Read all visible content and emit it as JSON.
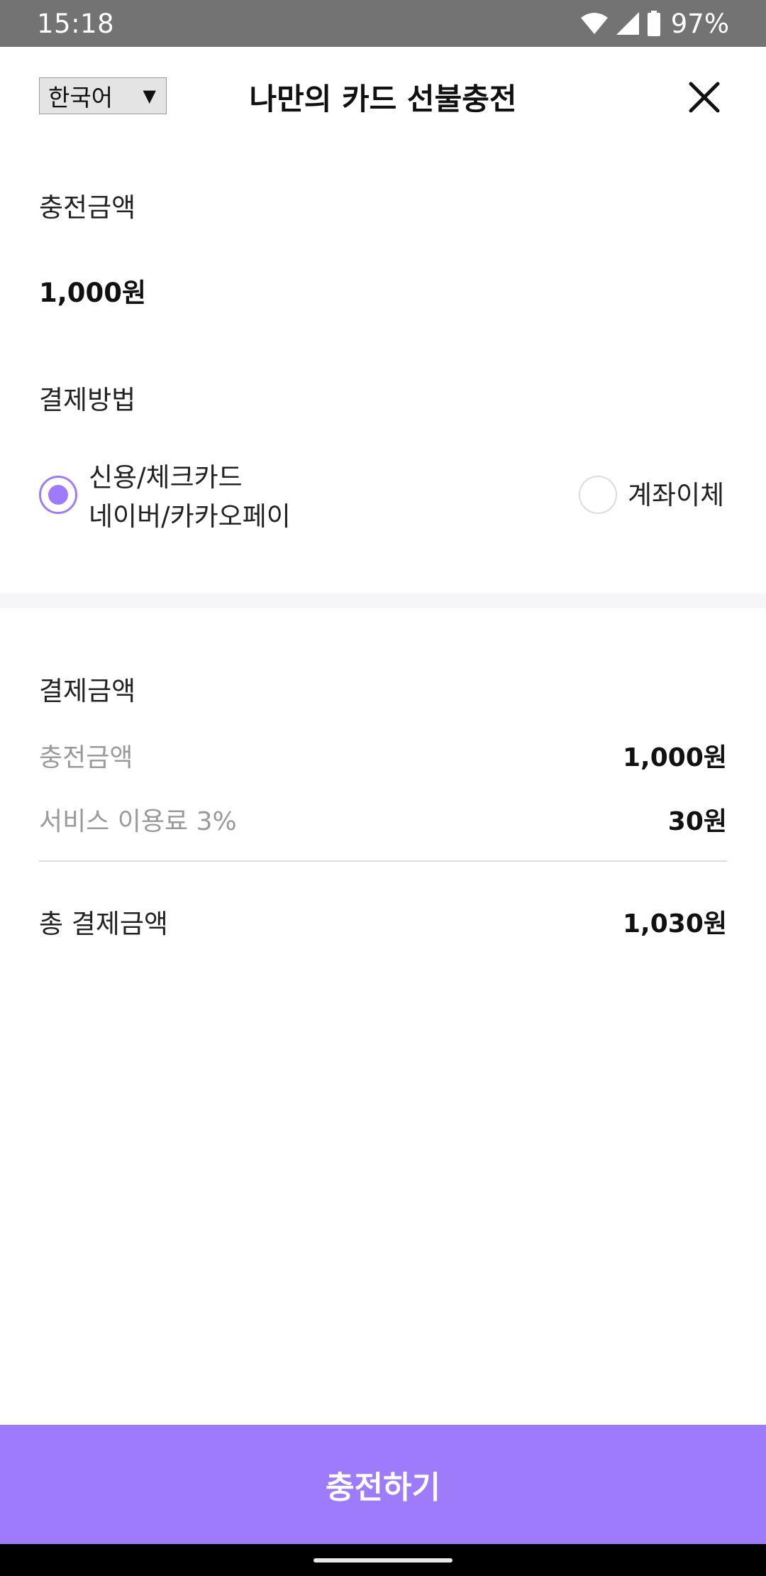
{
  "status_bar": {
    "time": "15:18",
    "battery": "97%",
    "icons": [
      "wifi-icon",
      "cell-signal-icon",
      "battery-icon"
    ]
  },
  "header": {
    "language": "한국어",
    "title": "나만의 카드 선불충전",
    "close_icon": "close-icon"
  },
  "charge_amount": {
    "label": "충전금액",
    "value": "1,000원"
  },
  "payment_method": {
    "label": "결제방법",
    "options": [
      {
        "line1": "신용/체크카드",
        "line2": "네이버/카카오페이",
        "selected": true
      },
      {
        "line1": "계좌이체",
        "selected": false
      }
    ]
  },
  "summary": {
    "title": "결제금액",
    "rows": [
      {
        "label": "충전금액",
        "value": "1,000원"
      },
      {
        "label": "서비스 이용료 3%",
        "value": "30원"
      }
    ],
    "total_label": "총 결제금액",
    "total_value": "1,030원"
  },
  "charge_button": "충전하기",
  "colors": {
    "accent": "#9d7bfb",
    "status_bar": "#737373"
  }
}
